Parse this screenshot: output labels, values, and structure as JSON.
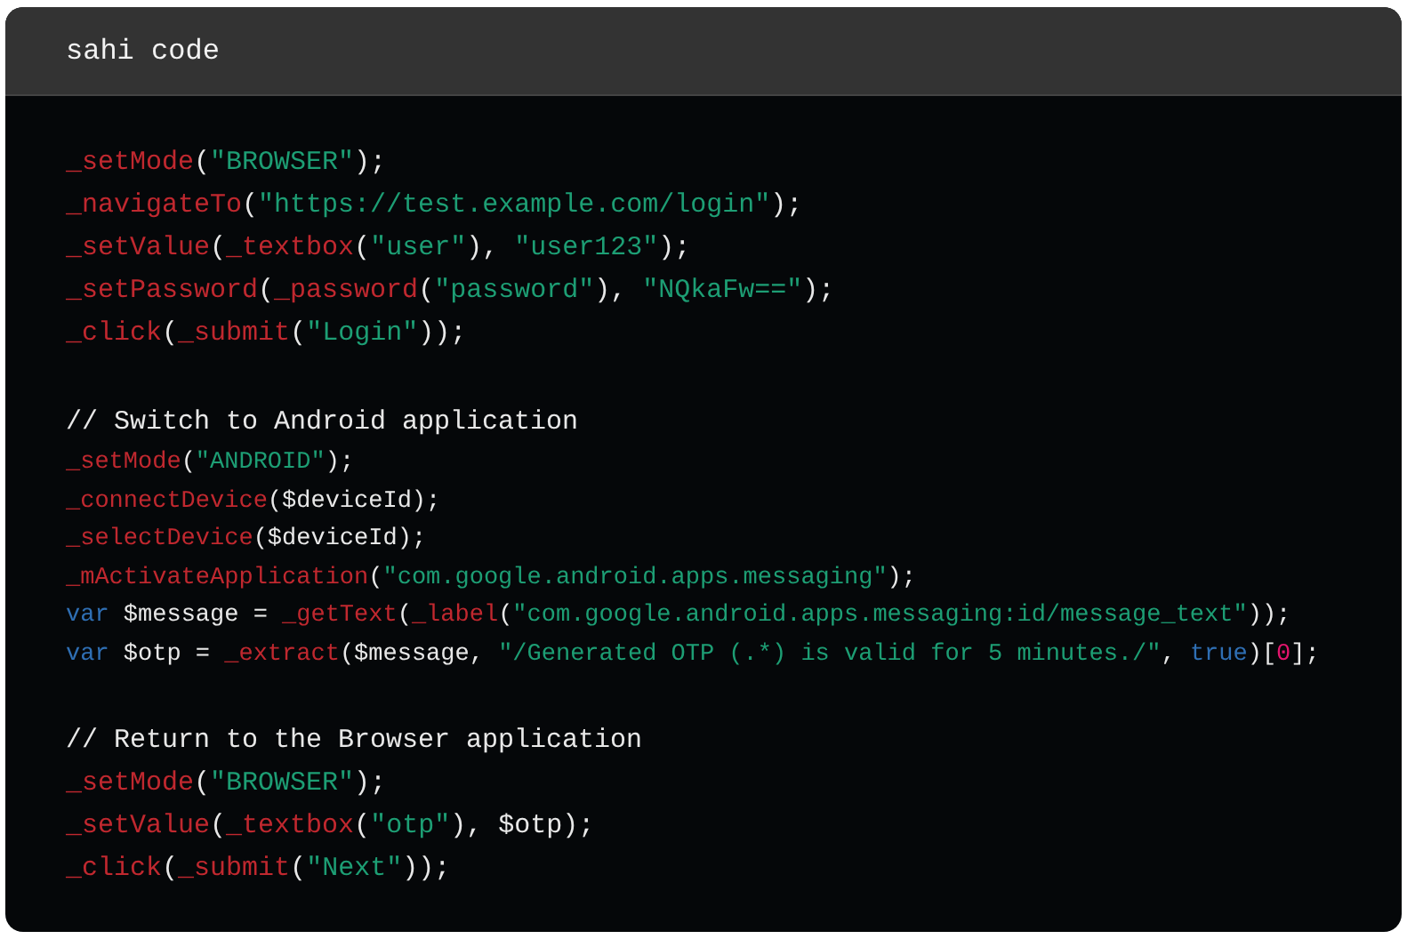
{
  "header": {
    "title": "sahi code"
  },
  "blocks": [
    {
      "kind": "regular",
      "lines": [
        {
          "kind": "code",
          "tokens": [
            {
              "kind": "fn",
              "text": "_setMode"
            },
            {
              "kind": "plain",
              "text": "("
            },
            {
              "kind": "str",
              "text": "\"BROWSER\""
            },
            {
              "kind": "plain",
              "text": ");"
            }
          ]
        },
        {
          "kind": "code",
          "tokens": [
            {
              "kind": "fn",
              "text": "_navigateTo"
            },
            {
              "kind": "plain",
              "text": "("
            },
            {
              "kind": "str",
              "text": "\"https://test.example.com/login\""
            },
            {
              "kind": "plain",
              "text": ");"
            }
          ]
        },
        {
          "kind": "code",
          "tokens": [
            {
              "kind": "fn",
              "text": "_setValue"
            },
            {
              "kind": "plain",
              "text": "("
            },
            {
              "kind": "fn",
              "text": "_textbox"
            },
            {
              "kind": "plain",
              "text": "("
            },
            {
              "kind": "str",
              "text": "\"user\""
            },
            {
              "kind": "plain",
              "text": "), "
            },
            {
              "kind": "str",
              "text": "\"user123\""
            },
            {
              "kind": "plain",
              "text": ");"
            }
          ]
        },
        {
          "kind": "code",
          "tokens": [
            {
              "kind": "fn",
              "text": "_setPassword"
            },
            {
              "kind": "plain",
              "text": "("
            },
            {
              "kind": "fn",
              "text": "_password"
            },
            {
              "kind": "plain",
              "text": "("
            },
            {
              "kind": "str",
              "text": "\"password\""
            },
            {
              "kind": "plain",
              "text": "), "
            },
            {
              "kind": "str",
              "text": "\"NQkaFw==\""
            },
            {
              "kind": "plain",
              "text": ");"
            }
          ]
        },
        {
          "kind": "code",
          "tokens": [
            {
              "kind": "fn",
              "text": "_click"
            },
            {
              "kind": "plain",
              "text": "("
            },
            {
              "kind": "fn",
              "text": "_submit"
            },
            {
              "kind": "plain",
              "text": "("
            },
            {
              "kind": "str",
              "text": "\"Login\""
            },
            {
              "kind": "plain",
              "text": "));"
            }
          ]
        }
      ]
    },
    {
      "kind": "compact",
      "lines": [
        {
          "kind": "comment",
          "tokens": [
            {
              "kind": "plain",
              "text": "// Switch to Android application"
            }
          ]
        },
        {
          "kind": "code",
          "tokens": [
            {
              "kind": "fn",
              "text": "_setMode"
            },
            {
              "kind": "plain",
              "text": "("
            },
            {
              "kind": "str",
              "text": "\"ANDROID\""
            },
            {
              "kind": "plain",
              "text": ");"
            }
          ]
        },
        {
          "kind": "code",
          "tokens": [
            {
              "kind": "fn",
              "text": "_connectDevice"
            },
            {
              "kind": "plain",
              "text": "($deviceId);"
            }
          ]
        },
        {
          "kind": "code",
          "tokens": [
            {
              "kind": "fn",
              "text": "_selectDevice"
            },
            {
              "kind": "plain",
              "text": "($deviceId);"
            }
          ]
        },
        {
          "kind": "code",
          "tokens": [
            {
              "kind": "fn",
              "text": "_mActivateApplication"
            },
            {
              "kind": "plain",
              "text": "("
            },
            {
              "kind": "str",
              "text": "\"com.google.android.apps.messaging\""
            },
            {
              "kind": "plain",
              "text": ");"
            }
          ]
        },
        {
          "kind": "code",
          "tokens": [
            {
              "kind": "kw",
              "text": "var"
            },
            {
              "kind": "plain",
              "text": " $message = "
            },
            {
              "kind": "fn",
              "text": "_getText"
            },
            {
              "kind": "plain",
              "text": "("
            },
            {
              "kind": "fn",
              "text": "_label"
            },
            {
              "kind": "plain",
              "text": "("
            },
            {
              "kind": "str",
              "text": "\"com.google.android.apps.messaging:id/message_text\""
            },
            {
              "kind": "plain",
              "text": "));"
            }
          ]
        },
        {
          "kind": "code",
          "tokens": [
            {
              "kind": "kw",
              "text": "var"
            },
            {
              "kind": "plain",
              "text": " $otp = "
            },
            {
              "kind": "fn",
              "text": "_extract"
            },
            {
              "kind": "plain",
              "text": "($message, "
            },
            {
              "kind": "str",
              "text": "\"/Generated OTP (.*) is valid for 5 minutes./\""
            },
            {
              "kind": "plain",
              "text": ", "
            },
            {
              "kind": "kw",
              "text": "true"
            },
            {
              "kind": "plain",
              "text": ")["
            },
            {
              "kind": "num",
              "text": "0"
            },
            {
              "kind": "plain",
              "text": "];"
            }
          ]
        }
      ]
    },
    {
      "kind": "regular",
      "lines": [
        {
          "kind": "comment",
          "tokens": [
            {
              "kind": "plain",
              "text": "// Return to the Browser application"
            }
          ]
        },
        {
          "kind": "code",
          "tokens": [
            {
              "kind": "fn",
              "text": "_setMode"
            },
            {
              "kind": "plain",
              "text": "("
            },
            {
              "kind": "str",
              "text": "\"BROWSER\""
            },
            {
              "kind": "plain",
              "text": ");"
            }
          ]
        },
        {
          "kind": "code",
          "tokens": [
            {
              "kind": "fn",
              "text": "_setValue"
            },
            {
              "kind": "plain",
              "text": "("
            },
            {
              "kind": "fn",
              "text": "_textbox"
            },
            {
              "kind": "plain",
              "text": "("
            },
            {
              "kind": "str",
              "text": "\"otp\""
            },
            {
              "kind": "plain",
              "text": "), $otp);"
            }
          ]
        },
        {
          "kind": "code",
          "tokens": [
            {
              "kind": "fn",
              "text": "_click"
            },
            {
              "kind": "plain",
              "text": "("
            },
            {
              "kind": "fn",
              "text": "_submit"
            },
            {
              "kind": "plain",
              "text": "("
            },
            {
              "kind": "str",
              "text": "\"Next\""
            },
            {
              "kind": "plain",
              "text": "));"
            }
          ]
        }
      ]
    }
  ]
}
